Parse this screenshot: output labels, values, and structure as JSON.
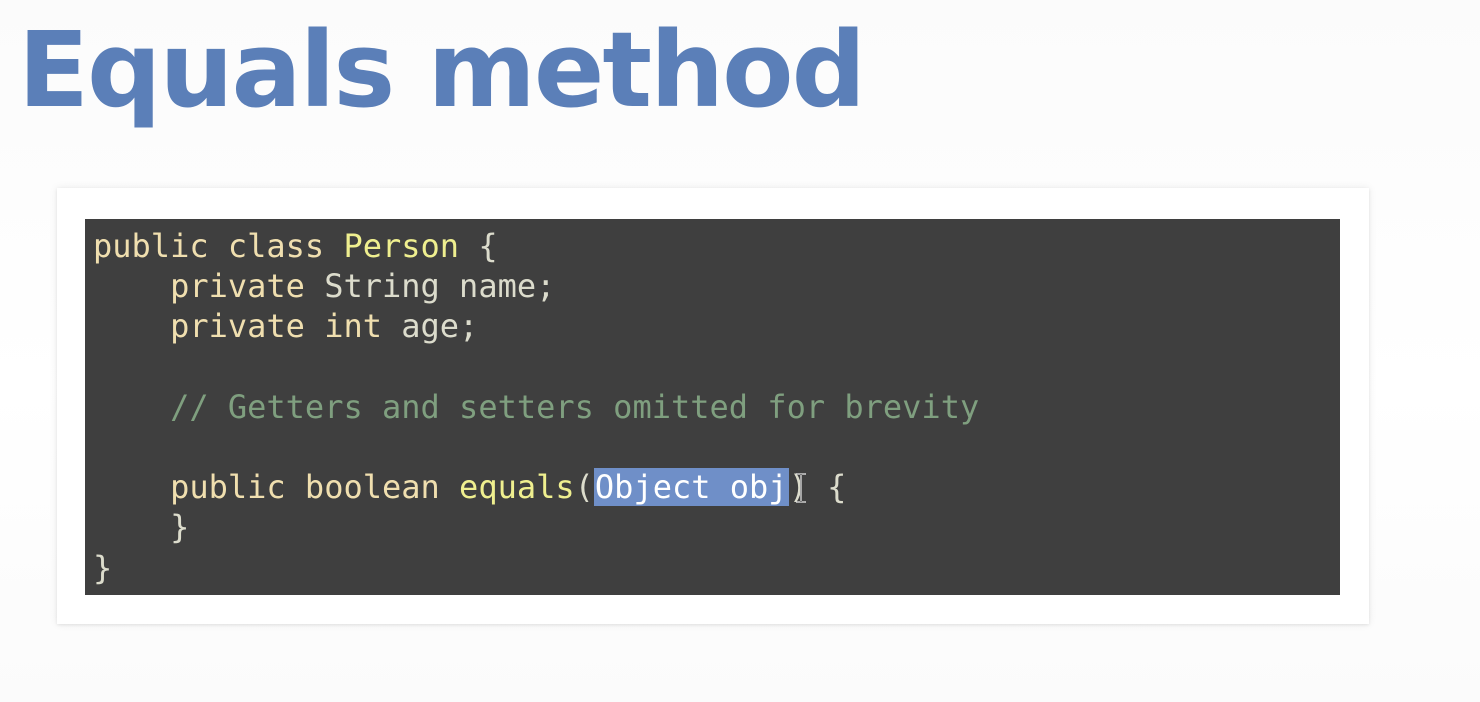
{
  "slide": {
    "title": "Equals method"
  },
  "code": {
    "lines": [
      [
        {
          "text": "public",
          "class": "tok-kw"
        },
        {
          "text": " ",
          "class": "tok-punct"
        },
        {
          "text": "class",
          "class": "tok-kw"
        },
        {
          "text": " ",
          "class": "tok-punct"
        },
        {
          "text": "Person",
          "class": "tok-class"
        },
        {
          "text": " {",
          "class": "tok-punct"
        }
      ],
      [
        {
          "text": "    ",
          "class": "tok-punct"
        },
        {
          "text": "private",
          "class": "tok-kw"
        },
        {
          "text": " ",
          "class": "tok-punct"
        },
        {
          "text": "String",
          "class": "tok-type"
        },
        {
          "text": " ",
          "class": "tok-punct"
        },
        {
          "text": "name",
          "class": "tok-ident"
        },
        {
          "text": ";",
          "class": "tok-punct"
        }
      ],
      [
        {
          "text": "    ",
          "class": "tok-punct"
        },
        {
          "text": "private",
          "class": "tok-kw"
        },
        {
          "text": " ",
          "class": "tok-punct"
        },
        {
          "text": "int",
          "class": "tok-kw"
        },
        {
          "text": " ",
          "class": "tok-punct"
        },
        {
          "text": "age",
          "class": "tok-ident"
        },
        {
          "text": ";",
          "class": "tok-punct"
        }
      ],
      [],
      [
        {
          "text": "    ",
          "class": "tok-punct"
        },
        {
          "text": "// Getters and setters omitted for brevity",
          "class": "tok-comment"
        }
      ],
      [],
      [
        {
          "text": "    ",
          "class": "tok-punct"
        },
        {
          "text": "public",
          "class": "tok-kw"
        },
        {
          "text": " ",
          "class": "tok-punct"
        },
        {
          "text": "boolean",
          "class": "tok-kw"
        },
        {
          "text": " ",
          "class": "tok-punct"
        },
        {
          "text": "equals",
          "class": "tok-fn"
        },
        {
          "text": "(",
          "class": "tok-punct"
        },
        {
          "text": "Object obj",
          "class": "tok-selected"
        },
        {
          "text": ") {",
          "class": "tok-punct"
        }
      ],
      [
        {
          "text": "    }",
          "class": "tok-punct"
        }
      ],
      [
        {
          "text": "}",
          "class": "tok-punct"
        }
      ]
    ]
  },
  "theme": {
    "title_color": "#5b7fb8",
    "code_background": "#3f3f3f",
    "selection_color": "#6f8fc8"
  },
  "icons": {
    "cursor": "text-cursor-icon"
  }
}
